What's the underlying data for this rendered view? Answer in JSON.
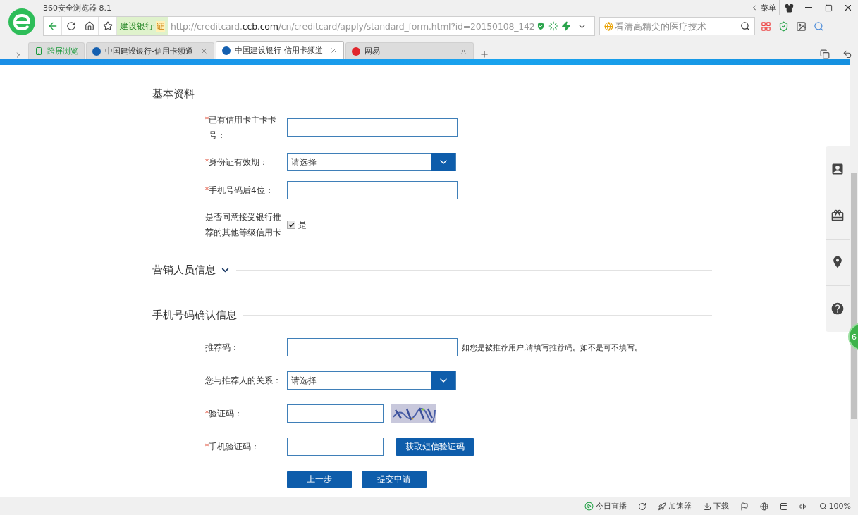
{
  "browser": {
    "title": "360安全浏览器 8.1",
    "menu": "菜单"
  },
  "address_bar": {
    "site_badge": "建设银行",
    "cert_badge": "证",
    "url": {
      "prefix": "http://creditcard.",
      "domain": "ccb.com",
      "path": "/cn/creditcard/apply/standard_form.html?id=20150108_142"
    },
    "search": {
      "placeholder": "看清高精尖的医疗技术"
    }
  },
  "tabs": [
    {
      "kind": "tool",
      "label": "跨屏浏览",
      "selected": false
    },
    {
      "kind": "page",
      "label": "中国建设银行-信用卡频道",
      "color": "#1560b0",
      "selected": false
    },
    {
      "kind": "page",
      "label": "中国建设银行-信用卡频道",
      "color": "#1560b0",
      "selected": true
    },
    {
      "kind": "page",
      "label": "网易",
      "color": "#e0262c",
      "selected": false
    }
  ],
  "form": {
    "sections": [
      {
        "title": "基本资料",
        "fields": [
          {
            "kind": "input",
            "label": "已有信用卡主卡卡号：",
            "required": true
          },
          {
            "kind": "select",
            "label": "身份证有效期：",
            "required": true,
            "value": "请选择"
          },
          {
            "kind": "input",
            "label": "手机号码后4位：",
            "required": true
          },
          {
            "kind": "checkbox",
            "label": "是否同意接受银行推荐的其他等级信用卡",
            "required": false,
            "option": "是",
            "checked": true
          }
        ]
      },
      {
        "title": "营销人员信息",
        "expanded": false
      },
      {
        "title": "手机号码确认信息",
        "fields": [
          {
            "kind": "input",
            "label": "推荐码：",
            "required": false,
            "hint": "如您是被推荐用户,请填写推荐码。如不是可不填写。"
          },
          {
            "kind": "select",
            "label": "您与推荐人的关系：",
            "required": false,
            "value": "请选择"
          },
          {
            "kind": "captcha",
            "label": "验证码：",
            "required": true
          },
          {
            "kind": "sms",
            "label": "手机验证码：",
            "required": true,
            "button": "获取短信验证码"
          }
        ]
      }
    ],
    "actions": [
      "上一步",
      "提交申请"
    ]
  },
  "side_badge": "6",
  "status_bar": {
    "live": "今日直播",
    "accelerator": "加速器",
    "download": "下载",
    "zoom": "100%"
  }
}
